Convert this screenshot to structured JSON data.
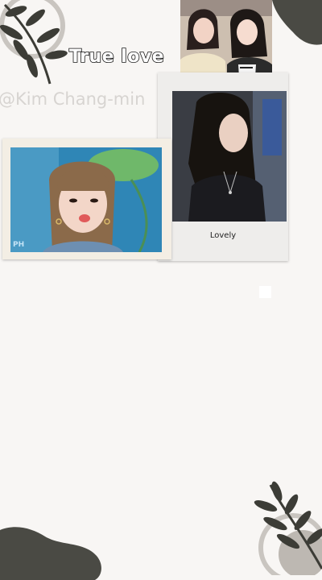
{
  "story": {
    "title": "True love",
    "watermark": "@Kim Chang-min",
    "caption": "Lovely",
    "photo_mark": "PH"
  },
  "colors": {
    "background": "#f8f6f4",
    "blob": "#4a4a44",
    "leaf": "#3c3c36",
    "circle": "#c9c5c0"
  },
  "images": {
    "duo": "photo-two-women-smiling",
    "jennie": "photo-woman-long-dark-hair-black-top",
    "lisa": "photo-woman-bangs-pouting-leaf-background"
  }
}
